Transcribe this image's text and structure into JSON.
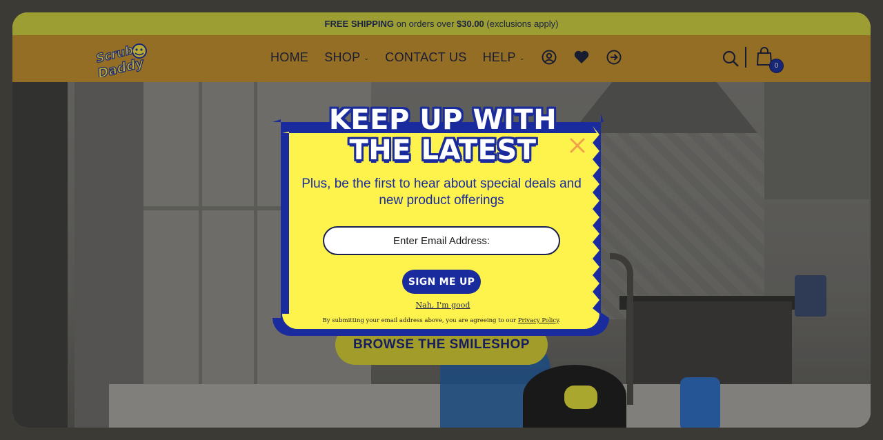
{
  "promo": {
    "bold_1": "FREE SHIPPING",
    "text_1": " on orders over ",
    "bold_2": "$30.00",
    "text_2": " (exclusions apply)"
  },
  "header": {
    "logo_line1": "Scrub",
    "logo_line2": "Daddy",
    "nav": [
      "HOME",
      "SHOP",
      "CONTACT US",
      "HELP"
    ],
    "cart_count": "0",
    "icons": [
      "account-icon",
      "heart-icon",
      "arrow-circle-right-icon",
      "search-icon",
      "cart-icon"
    ]
  },
  "hero": {
    "cta_label": "BROWSE THE SMILESHOP"
  },
  "modal": {
    "title_line1": "KEEP UP WITH",
    "title_line2": "THE LATEST",
    "subtitle": "Plus, be the first to hear about special deals and new product offerings",
    "email_placeholder": "Enter Email Address:",
    "signup_label": "SIGN ME UP",
    "decline_label": "Nah, I'm good",
    "legal_text": "By submitting your email address above, you are agreeing to our ",
    "legal_link": "Privacy Policy",
    "legal_end": ".",
    "colors": {
      "yellow": "#fef24d",
      "blue": "#1a2b9d",
      "close": "#f0a24a"
    }
  }
}
